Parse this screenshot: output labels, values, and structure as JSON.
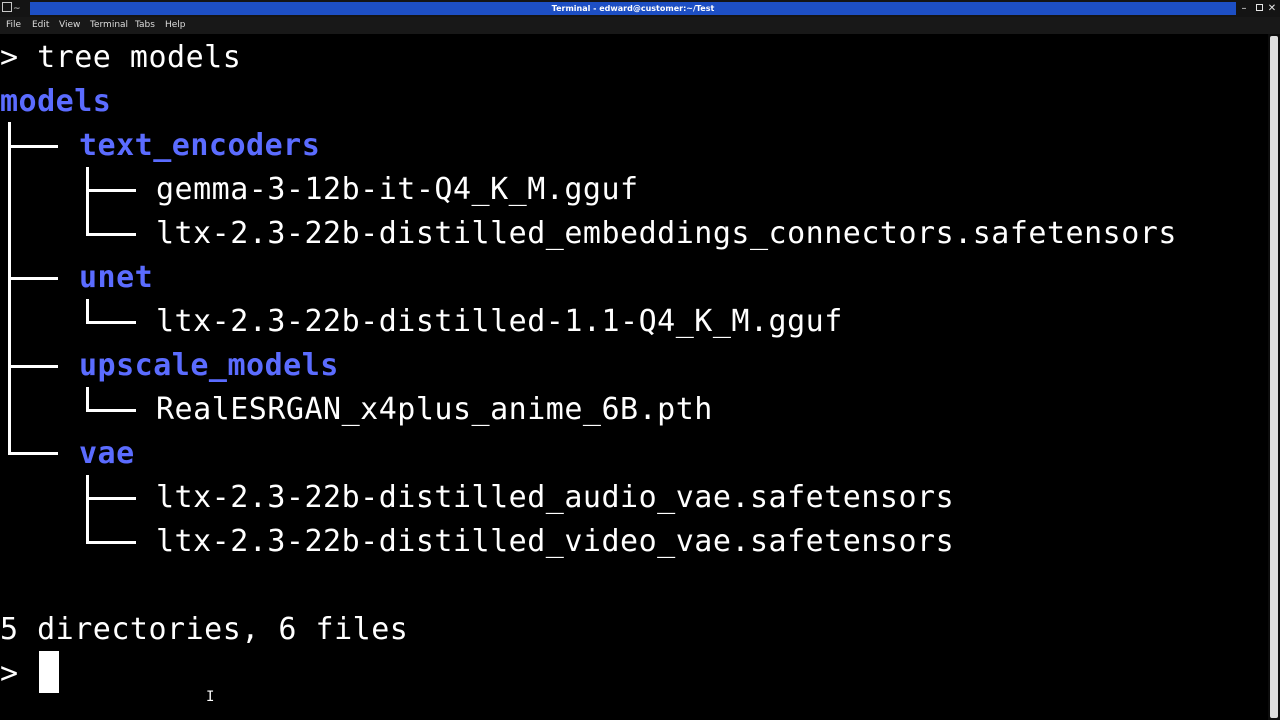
{
  "window": {
    "title": "Terminal - edward@customer:~/Test",
    "app_icon_glyph": "~",
    "minimize_glyph": "–",
    "close_glyph": "✕"
  },
  "menu": [
    "File",
    "Edit",
    "View",
    "Terminal",
    "Tabs",
    "Help"
  ],
  "terminal": {
    "prompt_symbol": ">",
    "command": "tree models",
    "root": "models",
    "tree": [
      {
        "name": "text_encoders",
        "files": [
          "gemma-3-12b-it-Q4_K_M.gguf",
          "ltx-2.3-22b-distilled_embeddings_connectors.safetensors"
        ]
      },
      {
        "name": "unet",
        "files": [
          "ltx-2.3-22b-distilled-1.1-Q4_K_M.gguf"
        ]
      },
      {
        "name": "upscale_models",
        "files": [
          "RealESRGAN_x4plus_anime_6B.pth"
        ]
      },
      {
        "name": "vae",
        "files": [
          "ltx-2.3-22b-distilled_audio_vae.safetensors",
          "ltx-2.3-22b-distilled_video_vae.safetensors"
        ]
      }
    ],
    "summary": "5 directories, 6 files"
  },
  "colors": {
    "background": "#000000",
    "directory": "#5b6cff",
    "text": "#ffffff",
    "title_strip": "#1d4fc4"
  },
  "icons": {
    "app": "terminal-icon",
    "maximize": "maximize-icon",
    "cursor": "text-ibeam-icon"
  }
}
